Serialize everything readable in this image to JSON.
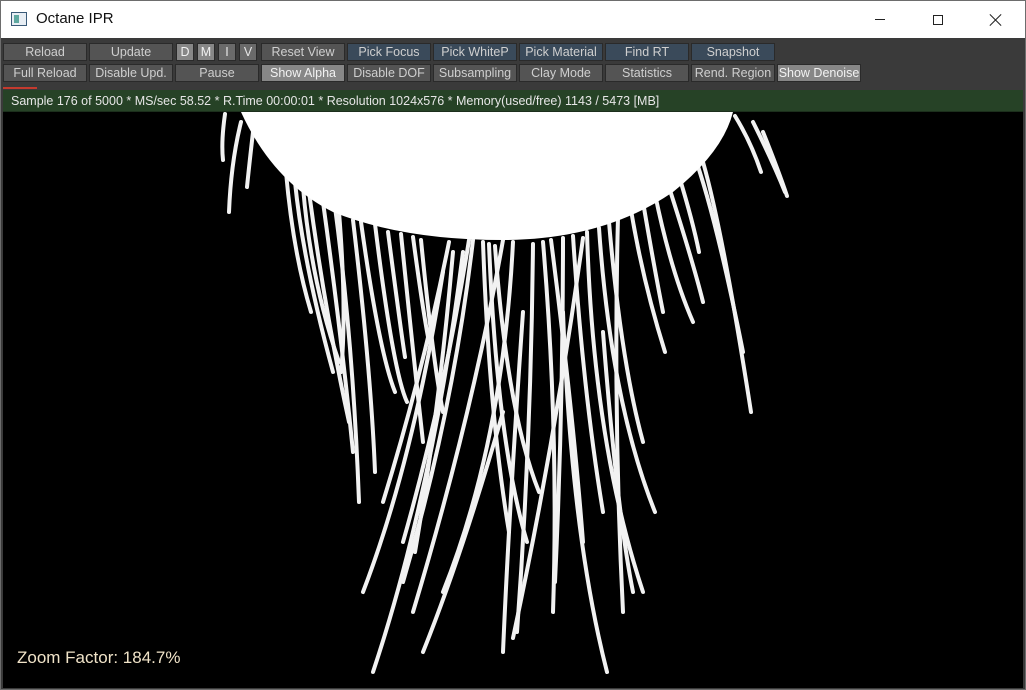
{
  "window": {
    "title": "Octane IPR"
  },
  "toolbar": {
    "row1": [
      "Reload",
      "Update",
      "D",
      "M",
      "I",
      "V",
      "Reset View",
      "Pick Focus",
      "Pick WhiteP",
      "Pick Material",
      "Find RT",
      "Snapshot"
    ],
    "row2": [
      "Full Reload",
      "Disable Upd.",
      "Pause",
      "Show Alpha",
      "Disable DOF",
      "Subsampling",
      "Clay Mode",
      "Statistics",
      "Rend. Region",
      "Show Denoise"
    ]
  },
  "status": {
    "text": "Sample 176 of 5000 * MS/sec 58.52 * R.Time 00:00:01 * Resolution 1024x576 * Memory(used/free) 1143 / 5473 [MB]"
  },
  "viewport": {
    "zoom_text": "Zoom Factor: 184.7%"
  }
}
